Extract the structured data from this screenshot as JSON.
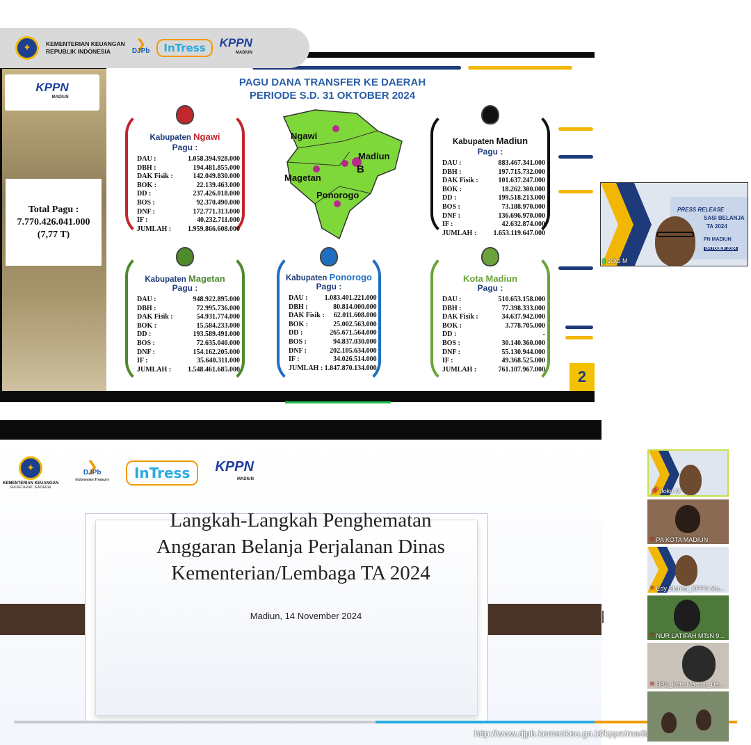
{
  "header": {
    "org_line1": "KEMENTERIAN KEUANGAN",
    "org_line2": "REPUBLIK INDONESIA",
    "djpb": "DJPb",
    "intress": "InTress",
    "kppn": "KPPN",
    "kppn_sub": "MADIUN"
  },
  "slide1": {
    "title_line1": "PAGU DANA TRANSFER KE DAERAH",
    "title_line2": "PERIODE S.D. 31 OKTOBER 2024",
    "side_kppn": "KPPN",
    "side_kppn_sub": "MADIUN",
    "total_label": "Total Pagu :",
    "total_value": "7.770.426.041.000",
    "total_short": "(7,77 T)",
    "page_number": "2",
    "map_labels": [
      "Ngawi",
      "Madiun",
      "Magetan",
      "Ponorogo",
      "B"
    ],
    "cards": [
      {
        "name_prefix": "Kabupaten",
        "name_main": "Ngawi",
        "pagu": "Pagu :",
        "color": "#c1272d",
        "rows": [
          [
            "DAU :",
            "1.058.394.928.000"
          ],
          [
            "DBH :",
            "194.481.855.000"
          ],
          [
            "DAK Fisik :",
            "142.049.830.000"
          ],
          [
            "BOK :",
            "22.139.463.000"
          ],
          [
            "DD :",
            "237.426.018.000"
          ],
          [
            "BOS :",
            "92.370.490.000"
          ],
          [
            "DNF :",
            "172.771.313.000"
          ],
          [
            "IF :",
            "40.232.711.000"
          ],
          [
            "JUMLAH :",
            "1.959.866.608.000"
          ]
        ]
      },
      {
        "name_prefix": "Kabupaten",
        "name_main": "Madiun",
        "pagu": "Pagu :",
        "color": "#111111",
        "rows": [
          [
            "DAU :",
            "883.467.341.000"
          ],
          [
            "DBH :",
            "197.715.732.000"
          ],
          [
            "DAK Fisik :",
            "101.637.247.000"
          ],
          [
            "BOK :",
            "18.262.300.000"
          ],
          [
            "DD :",
            "199.518.213.000"
          ],
          [
            "BOS :",
            "73.188.970.000"
          ],
          [
            "DNF :",
            "136.696.970.000"
          ],
          [
            "IF :",
            "42.632.874.000"
          ],
          [
            "JUMLAH :",
            "1.653.119.647.000"
          ]
        ]
      },
      {
        "name_prefix": "Kabupaten",
        "name_main": "Magetan",
        "pagu": "Pagu :",
        "color": "#4f8a2b",
        "rows": [
          [
            "DAU :",
            "948.922.895.000"
          ],
          [
            "DBH :",
            "72.995.736.000"
          ],
          [
            "DAK Fisik :",
            "54.931.774.000"
          ],
          [
            "BOK :",
            "15.584.233.000"
          ],
          [
            "DD :",
            "193.589.491.000"
          ],
          [
            "BOS :",
            "72.635.040.000"
          ],
          [
            "DNF :",
            "154.162.205.000"
          ],
          [
            "IF :",
            "35.640.311.000"
          ],
          [
            "JUMLAH :",
            "1.548.461.685.000"
          ]
        ]
      },
      {
        "name_prefix": "Kabupaten",
        "name_main": "Ponorogo",
        "pagu": "Pagu :",
        "color": "#1f6fc1",
        "rows": [
          [
            "DAU :",
            "1.083.401.221.000"
          ],
          [
            "DBH :",
            "80.814.000.000"
          ],
          [
            "DAK Fisik :",
            "62.011.608.000"
          ],
          [
            "BOK :",
            "25.002.563.000"
          ],
          [
            "DD :",
            "265.671.564.000"
          ],
          [
            "BOS :",
            "94.837.030.000"
          ],
          [
            "DNF :",
            "202.105.634.000"
          ],
          [
            "IF :",
            "34.026.514.000"
          ],
          [
            "JUMLAH :",
            "1.847.870.134.000"
          ]
        ]
      },
      {
        "name_prefix": "",
        "name_main": "Kota Madiun",
        "pagu": "Pagu :",
        "color": "#6aa33a",
        "rows": [
          [
            "DAU :",
            "510.653.158.000"
          ],
          [
            "DBH :",
            "77.398.333.000"
          ],
          [
            "DAK Fisik :",
            "34.637.942.000"
          ],
          [
            "BOK :",
            "3.778.705.000"
          ],
          [
            "DD :",
            "-"
          ],
          [
            "BOS :",
            "30.140.360.000"
          ],
          [
            "DNF :",
            "55.130.944.000"
          ],
          [
            "IF :",
            "49.368.525.000"
          ],
          [
            "JUMLAH :",
            "761.107.967.000"
          ]
        ]
      }
    ]
  },
  "speaker_tile": {
    "name": "Joko M",
    "bg_title": "PRESS RELEASE",
    "bg_line2": "SASI BELANJA",
    "bg_line3": "TA 2024",
    "bg_line4": "PN MADIUN",
    "bg_line5": "OKTOBER 2024"
  },
  "slide2": {
    "org_line1": "KEMENTERIAN KEUANGAN",
    "org_line2": "SEKRETARIAT JENDERAL",
    "djpb": "DJPb",
    "djpb_sub": "Indonesian Treasury",
    "intress": "InTress",
    "kppn": "KPPN",
    "kppn_sub": "MADIUN",
    "title_line1": "Langkah-Langkah Penghematan",
    "title_line2": "Anggaran Belanja Perjalanan Dinas",
    "title_line3": "Kementerian/Lembaga TA 2024",
    "subtitle": "Madiun, 14 November 2024",
    "url": "http://www.djpb.kemenkeu.go.id/kppn/madiun"
  },
  "gallery": [
    {
      "name": "Joko M",
      "muted": false
    },
    {
      "name": "PA KOTA MADIUN",
      "muted": true
    },
    {
      "name": "Edy Slamet_KPPN Ma...",
      "muted": true
    },
    {
      "name": "NUR LATIFAH MTsN 9...",
      "muted": true
    },
    {
      "name": "BPS_Kota Madiun_Da...",
      "muted": true
    },
    {
      "name": "",
      "muted": false
    }
  ]
}
